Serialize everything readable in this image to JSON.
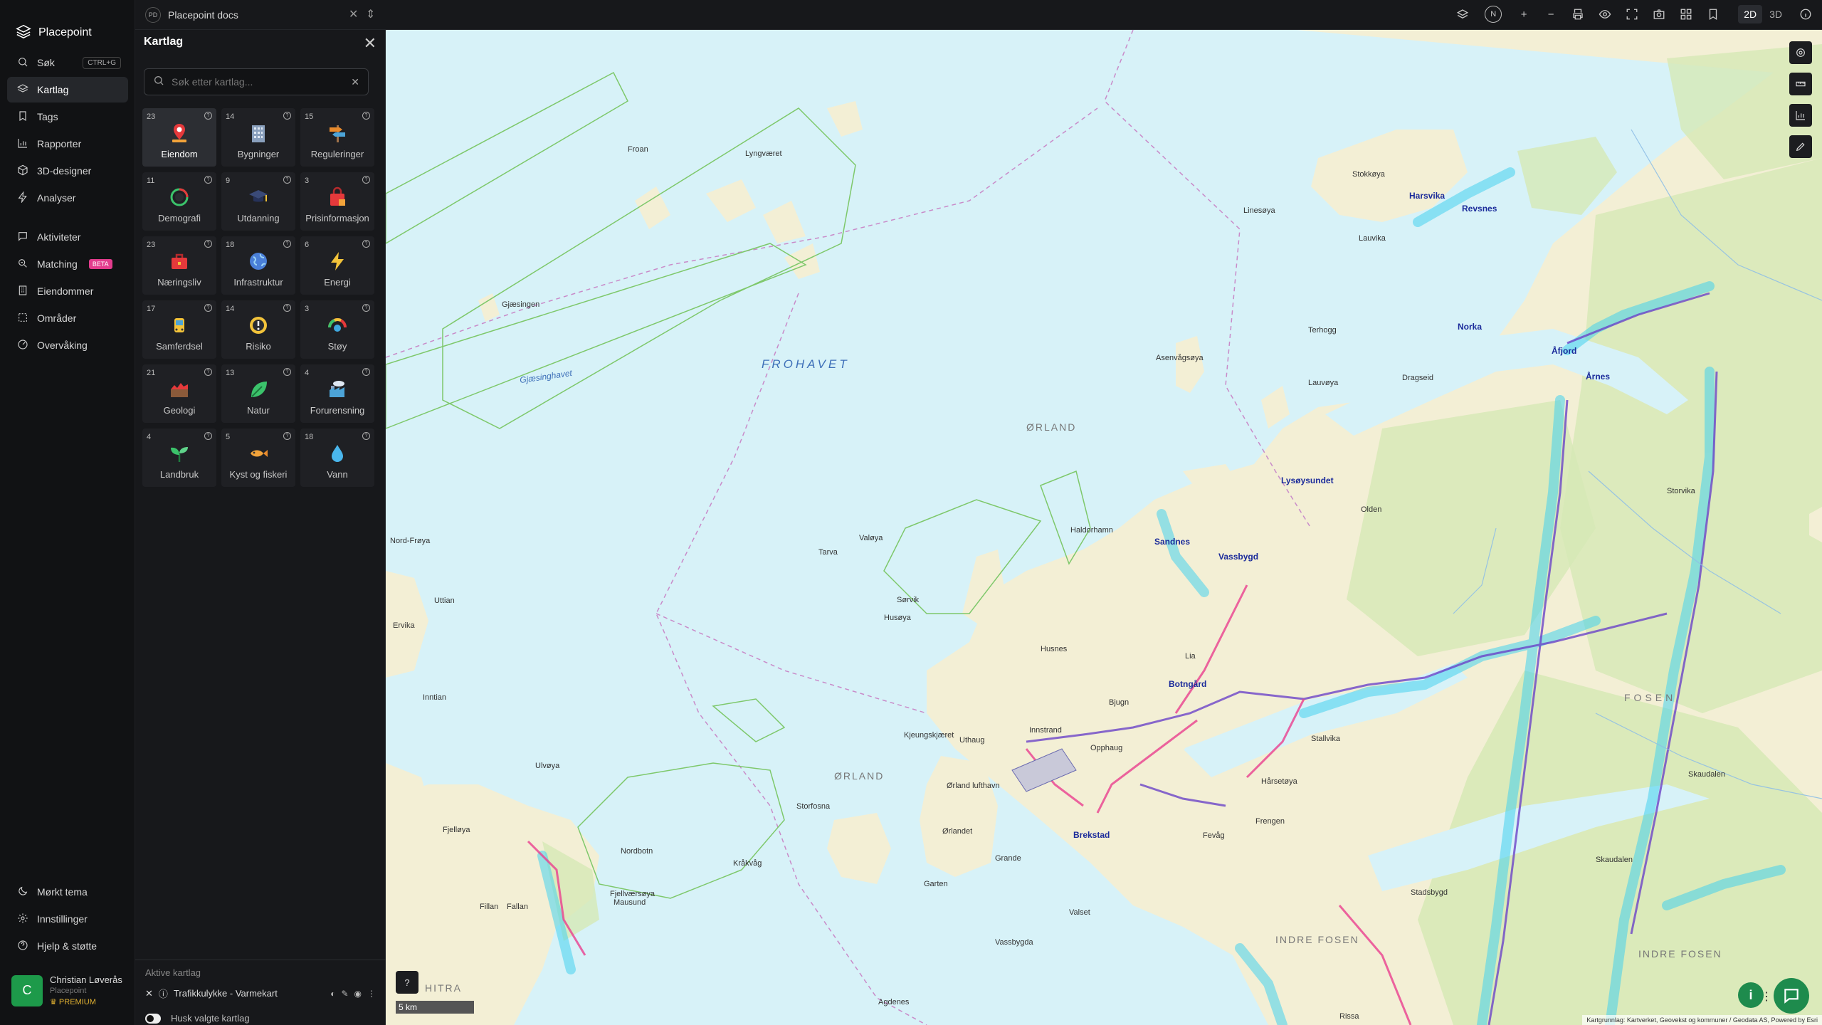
{
  "app": {
    "name": "Placepoint"
  },
  "topbar": {
    "doc_badge": "PD",
    "doc_title": "Placepoint docs",
    "north": "N",
    "mode_2d": "2D",
    "mode_3d": "3D"
  },
  "nav": {
    "items": [
      {
        "label": "Søk",
        "shortcut": "CTRL+G"
      },
      {
        "label": "Kartlag"
      },
      {
        "label": "Tags"
      },
      {
        "label": "Rapporter"
      },
      {
        "label": "3D-designer"
      },
      {
        "label": "Analyser"
      },
      {
        "label": "Aktiviteter"
      },
      {
        "label": "Matching",
        "badge": "BETA"
      },
      {
        "label": "Eiendommer"
      },
      {
        "label": "Områder"
      },
      {
        "label": "Overvåking"
      }
    ],
    "bottom": [
      {
        "label": "Mørkt tema"
      },
      {
        "label": "Innstillinger"
      },
      {
        "label": "Hjelp & støtte"
      }
    ],
    "user": {
      "initial": "C",
      "name": "Christian Løverås",
      "org": "Placepoint",
      "plan": "PREMIUM"
    }
  },
  "panel": {
    "title": "Kartlag",
    "search_placeholder": "Søk etter kartlag...",
    "tiles": [
      {
        "count": "23",
        "label": "Eiendom",
        "icon": "house-pin-icon"
      },
      {
        "count": "14",
        "label": "Bygninger",
        "icon": "building-icon"
      },
      {
        "count": "15",
        "label": "Reguleringer",
        "icon": "signpost-icon"
      },
      {
        "count": "11",
        "label": "Demografi",
        "icon": "demographics-icon"
      },
      {
        "count": "9",
        "label": "Utdanning",
        "icon": "graduation-cap-icon"
      },
      {
        "count": "3",
        "label": "Prisinformasjon",
        "icon": "shopping-bag-icon"
      },
      {
        "count": "23",
        "label": "Næringsliv",
        "icon": "briefcase-icon"
      },
      {
        "count": "18",
        "label": "Infrastruktur",
        "icon": "globe-icon"
      },
      {
        "count": "6",
        "label": "Energi",
        "icon": "lightning-icon"
      },
      {
        "count": "17",
        "label": "Samferdsel",
        "icon": "bus-icon"
      },
      {
        "count": "14",
        "label": "Risiko",
        "icon": "hazard-icon"
      },
      {
        "count": "3",
        "label": "Støy",
        "icon": "noise-gauge-icon"
      },
      {
        "count": "21",
        "label": "Geologi",
        "icon": "terrain-icon"
      },
      {
        "count": "13",
        "label": "Natur",
        "icon": "leaf-icon"
      },
      {
        "count": "4",
        "label": "Forurensning",
        "icon": "factory-icon"
      },
      {
        "count": "4",
        "label": "Landbruk",
        "icon": "sprout-icon"
      },
      {
        "count": "5",
        "label": "Kyst og fiskeri",
        "icon": "fish-icon"
      },
      {
        "count": "18",
        "label": "Vann",
        "icon": "water-drop-icon"
      }
    ],
    "active_title": "Aktive kartlag",
    "active_layers": [
      {
        "label": "Trafikkulykke - Varmekart"
      }
    ],
    "remember_label": "Husk valgte kartlag"
  },
  "map": {
    "sea_labels": [
      "FROHAVET",
      "Gjæsinghavet",
      "Frohavet"
    ],
    "region_labels": [
      "ØRLAND",
      "ØRLAND",
      "FOSEN",
      "INDRE FOSEN",
      "INDRE FOSEN",
      "HITRA"
    ],
    "places": [
      "Froan",
      "Lyngværet",
      "Gjæsingen",
      "Tarva",
      "Valøya",
      "Sørvik",
      "Husøya",
      "Asenvågsøya",
      "Linesøya",
      "Stokkøya",
      "Lauvika",
      "Terhogg",
      "Lauvøya",
      "Dragseid",
      "Kråkvåg",
      "Storfosna",
      "Agdenes",
      "Mausund",
      "Uthaug",
      "Ørland lufthavn",
      "Ørlandet",
      "Grande",
      "Garten",
      "Innstrand",
      "Opphaug",
      "Skaudalen",
      "Stallvika",
      "Hårsetøya",
      "Nord-Frøya",
      "Uttian",
      "Ervika",
      "Inntian",
      "Ulvøya",
      "Fjellværsøya",
      "Nordbotn",
      "Fillan",
      "Valset",
      "Vassbygda",
      "Fevåg",
      "Frengen",
      "Rissa",
      "Stadsbygd",
      "Fallan",
      "Kjeungskjæret",
      "Fjelløya",
      "Skaudalen",
      "Olden",
      "Haldorhamn",
      "Storvika",
      "Bjugn",
      "Husnes",
      "Lia"
    ],
    "towns": [
      "Åfjord",
      "Årnes",
      "Botngård",
      "Brekstad",
      "Lysøysundet",
      "Sandnes",
      "Vassbygd",
      "Revsnes",
      "Norka",
      "Harsvika"
    ],
    "scale": "5 km",
    "attribution": "Kartgrunnlag: Kartverket, Geovekst og kommuner / Geodata AS, Powered by Esri"
  }
}
